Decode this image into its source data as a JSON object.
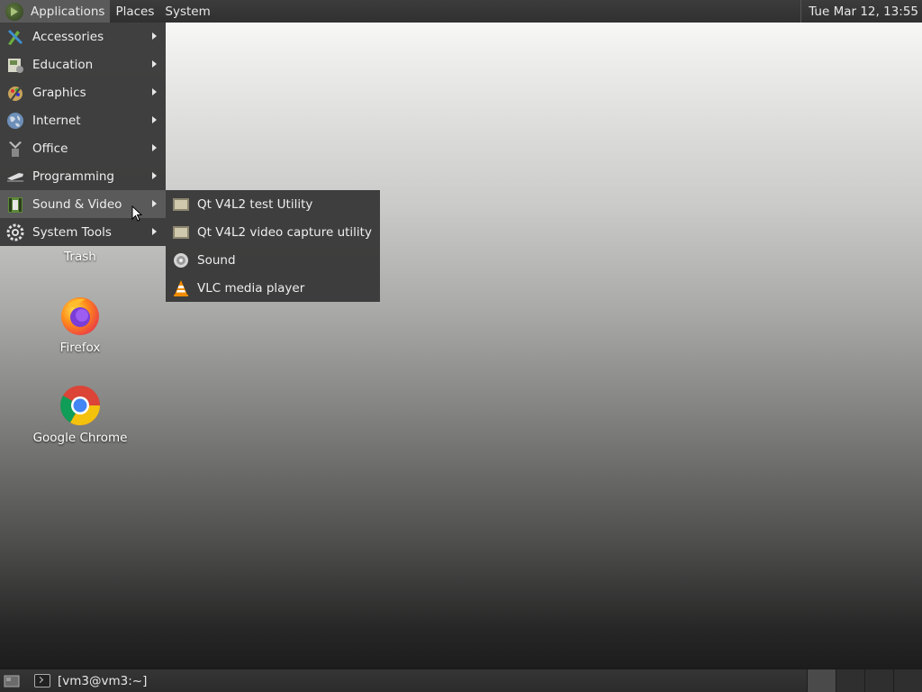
{
  "top_panel": {
    "applications": "Applications",
    "places": "Places",
    "system": "System",
    "clock": "Tue Mar 12, 13:55"
  },
  "apps_menu": {
    "items": [
      {
        "label": "Accessories",
        "icon": "accessories-icon"
      },
      {
        "label": "Education",
        "icon": "education-icon"
      },
      {
        "label": "Graphics",
        "icon": "graphics-icon"
      },
      {
        "label": "Internet",
        "icon": "internet-icon"
      },
      {
        "label": "Office",
        "icon": "office-icon"
      },
      {
        "label": "Programming",
        "icon": "programming-icon"
      },
      {
        "label": "Sound & Video",
        "icon": "sound-video-icon",
        "active": true
      },
      {
        "label": "System Tools",
        "icon": "system-tools-icon"
      }
    ]
  },
  "submenu": {
    "items": [
      {
        "label": "Qt V4L2 test Utility",
        "icon": "qt-v4l2-icon"
      },
      {
        "label": "Qt V4L2 video capture utility",
        "icon": "qt-v4l2-capture-icon"
      },
      {
        "label": "Sound",
        "icon": "sound-icon"
      },
      {
        "label": "VLC media player",
        "icon": "vlc-icon"
      }
    ]
  },
  "desktop_icons": {
    "trash": "Trash",
    "firefox": "Firefox",
    "chrome": "Google Chrome"
  },
  "bottom_panel": {
    "task": "[vm3@vm3:~]"
  },
  "colors": {
    "menu_bg": "#383838",
    "active_bg": "#5a5a5a",
    "text": "#eeeeee"
  }
}
